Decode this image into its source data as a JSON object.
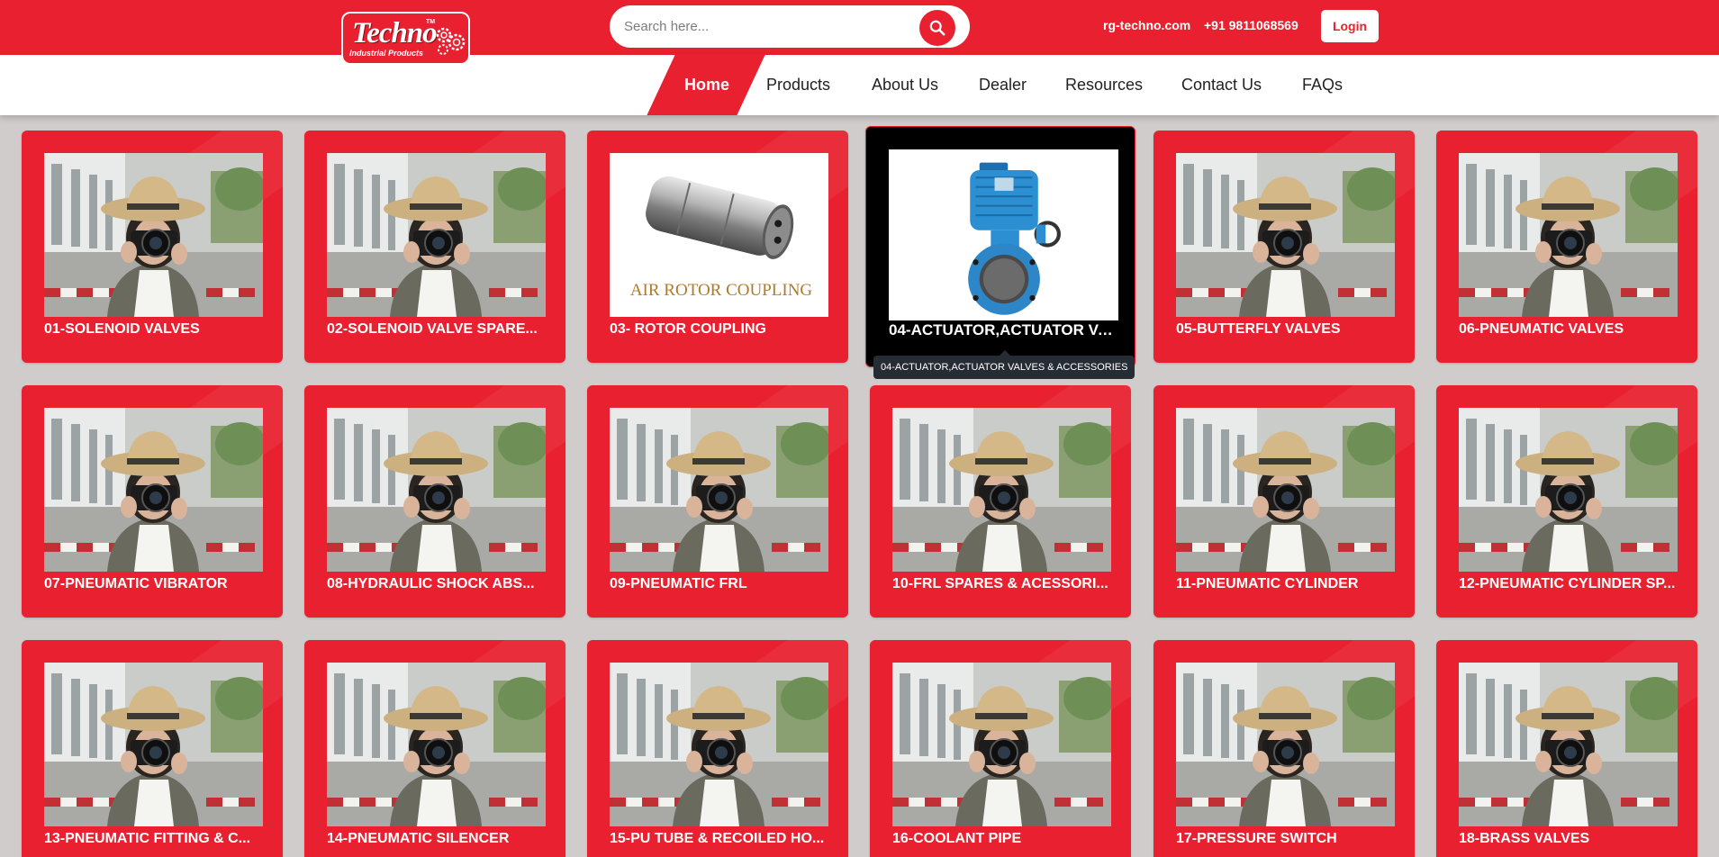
{
  "header": {
    "logo_text": "Techno",
    "logo_subtext": "Industrial Products",
    "logo_tm": "TM",
    "search_placeholder": "Search here...",
    "website": "rg-techno.com",
    "phone": "+91 9811068569",
    "login_label": "Login",
    "accent_color": "#e8202f"
  },
  "nav": {
    "items": [
      {
        "label": "Home",
        "active": true
      },
      {
        "label": "Products"
      },
      {
        "label": "About Us"
      },
      {
        "label": "Dealer"
      },
      {
        "label": "Resources"
      },
      {
        "label": "Contact Us"
      },
      {
        "label": "FAQs"
      }
    ]
  },
  "products": [
    {
      "label": "01-SOLENOID VALVES",
      "image": "photographer"
    },
    {
      "label": "02-SOLENOID VALVE SPARE...",
      "image": "photographer"
    },
    {
      "label": "03- ROTOR COUPLING",
      "image": "rotor-coupling",
      "image_text": "AIR ROTOR COUPLING"
    },
    {
      "label": "04-ACTUATOR,ACTUATOR VA...",
      "image": "actuator-valve",
      "hovered": true
    },
    {
      "label": "05-BUTTERFLY VALVES",
      "image": "photographer"
    },
    {
      "label": "06-PNEUMATIC VALVES",
      "image": "photographer"
    },
    {
      "label": "07-PNEUMATIC VIBRATOR",
      "image": "photographer"
    },
    {
      "label": "08-HYDRAULIC SHOCK ABS...",
      "image": "photographer"
    },
    {
      "label": "09-PNEUMATIC FRL",
      "image": "photographer"
    },
    {
      "label": "10-FRL SPARES & ACESSORI...",
      "image": "photographer"
    },
    {
      "label": "11-PNEUMATIC CYLINDER",
      "image": "photographer"
    },
    {
      "label": "12-PNEUMATIC CYLINDER SP...",
      "image": "photographer"
    },
    {
      "label": "13-PNEUMATIC FITTING & C...",
      "image": "photographer"
    },
    {
      "label": "14-PNEUMATIC SILENCER",
      "image": "photographer"
    },
    {
      "label": "15-PU TUBE & RECOILED HO...",
      "image": "photographer"
    },
    {
      "label": "16-COOLANT PIPE",
      "image": "photographer"
    },
    {
      "label": "17-PRESSURE SWITCH",
      "image": "photographer"
    },
    {
      "label": "18-BRASS VALVES",
      "image": "photographer"
    }
  ],
  "tooltip": {
    "text": "04-ACTUATOR,ACTUATOR VALVES & ACCESSORIES"
  }
}
